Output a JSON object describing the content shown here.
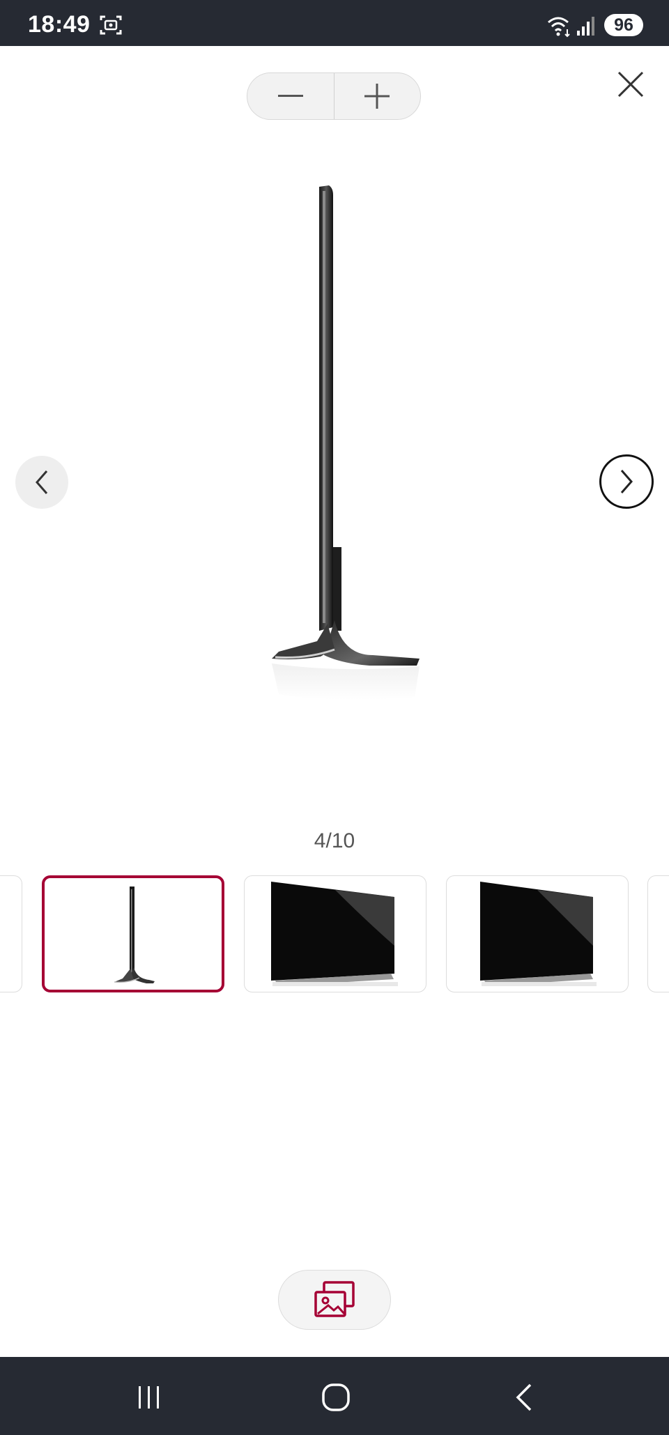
{
  "status_bar": {
    "time": "18:49",
    "battery": "96",
    "icons": [
      "screenshot-icon",
      "wifi-icon",
      "signal-icon"
    ]
  },
  "viewer": {
    "zoom_out_icon": "minus-icon",
    "zoom_in_icon": "plus-icon",
    "close_icon": "close-icon",
    "prev_icon": "chevron-left-icon",
    "next_icon": "chevron-right-icon",
    "counter": "4/10",
    "main_image": "tv-side-view"
  },
  "thumbnails": [
    {
      "image": "partial-thumbnail",
      "active": false
    },
    {
      "image": "tv-side-view",
      "active": true
    },
    {
      "image": "tv-angled-front",
      "active": false
    },
    {
      "image": "tv-angled-front",
      "active": false
    },
    {
      "image": "partial-thumbnail",
      "active": false
    }
  ],
  "gallery_button": {
    "icon": "gallery-icon"
  },
  "nav_bar": {
    "icons": [
      "recent-apps-icon",
      "home-icon",
      "back-icon"
    ]
  },
  "colors": {
    "accent": "#a50034",
    "status_bar": "#262a33"
  }
}
